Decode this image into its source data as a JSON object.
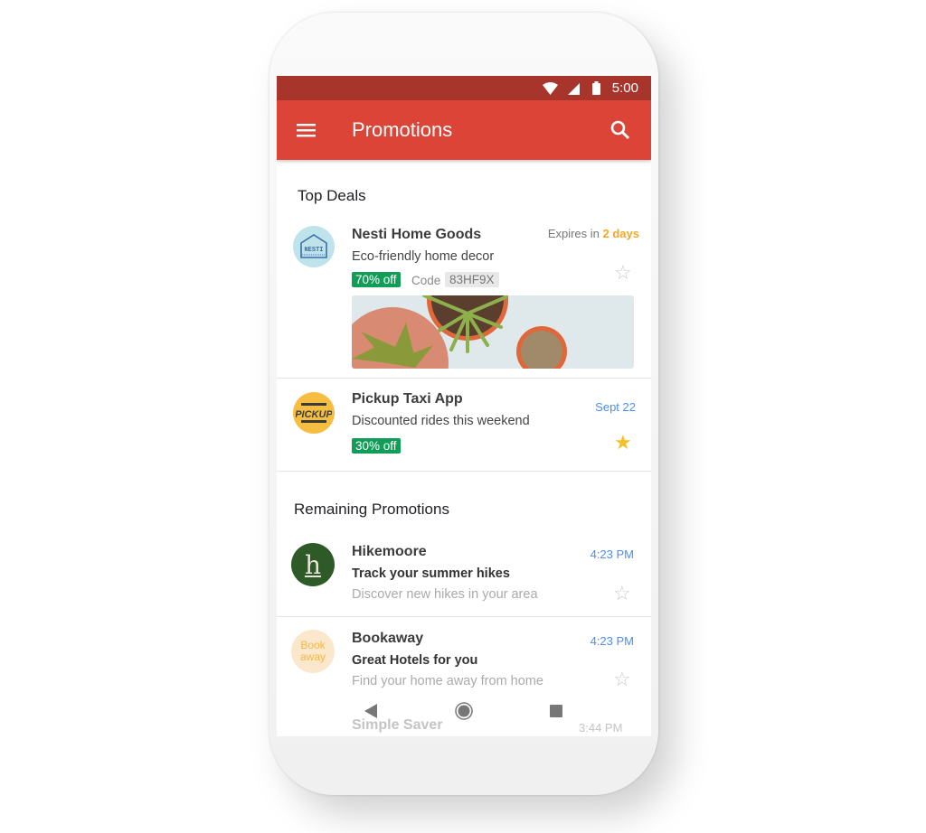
{
  "status_bar": {
    "time": "5:00",
    "icons": [
      "wifi-icon",
      "signal-icon",
      "battery-icon"
    ]
  },
  "app_bar": {
    "title": "Promotions",
    "menu_icon": "hamburger-menu-icon",
    "search_icon": "search-icon"
  },
  "colors": {
    "status_bar": "#a8352b",
    "app_bar": "#db4437",
    "badge": "#0f9d58",
    "accent_blue": "#4a8ff0",
    "expires_orange": "#f5a623",
    "star_filled": "#f6bf26"
  },
  "top_deals": {
    "heading": "Top Deals",
    "items": [
      {
        "sender": "Nesti Home Goods",
        "logo_text": "NESTI",
        "subject": "Eco-friendly home decor",
        "badge": "70% off",
        "code_label": "Code",
        "code": "83HF9X",
        "meta_prefix": "Expires in ",
        "meta_highlight": "2 days",
        "starred": false
      },
      {
        "sender": "Pickup Taxi App",
        "logo_text": "PICKUP",
        "subject": "Discounted rides this weekend",
        "badge": "30% off",
        "meta": "Sept 22",
        "starred": true
      }
    ]
  },
  "remaining": {
    "heading": "Remaining Promotions",
    "items": [
      {
        "sender": "Hikemoore",
        "logo_text": "h",
        "subject": "Track your summer hikes",
        "snippet": "Discover new hikes in your area",
        "time": "4:23 PM",
        "starred": false
      },
      {
        "sender": "Bookaway",
        "logo_text_1": "Book",
        "logo_text_2": "away",
        "subject": "Great Hotels for you",
        "snippet": "Find your home away from home",
        "time": "4:23 PM",
        "starred": false
      },
      {
        "sender": "Simple Saver",
        "time": "3:44 PM"
      }
    ]
  },
  "nav_bar": {
    "back_icon": "back-triangle-icon",
    "home_icon": "home-circle-icon",
    "recents_icon": "recents-square-icon"
  }
}
